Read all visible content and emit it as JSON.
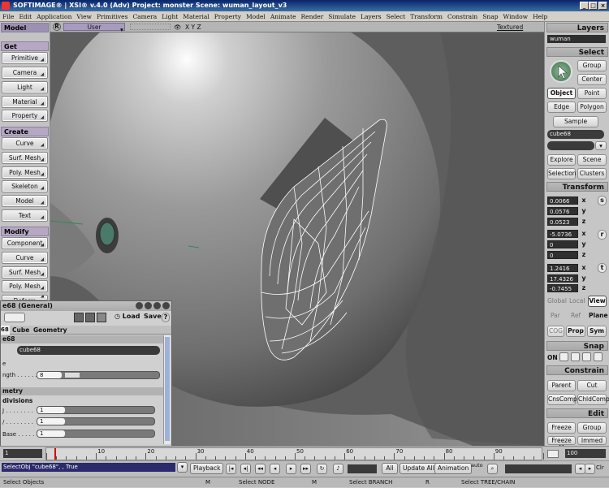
{
  "window": {
    "title": "SOFTIMAGE® | XSI® v.4.0 (Adv) Project: monster    Scene: wuman_layout_v3",
    "minimize": "_",
    "maximize": "□",
    "close": "×"
  },
  "menu": [
    "File",
    "Edit",
    "Application",
    "View",
    "Primitives",
    "Camera",
    "Light",
    "Material",
    "Property",
    "Model",
    "Animate",
    "Render",
    "Simulate",
    "Layers",
    "Select",
    "Transform",
    "Constrain",
    "Snap",
    "Window",
    "Help"
  ],
  "left_panel": {
    "mode": "Model",
    "get_header": "Get",
    "get_items": [
      "Primitive",
      "Camera",
      "Light",
      "Material",
      "Property"
    ],
    "create_header": "Create",
    "create_items": [
      "Curve",
      "Surf. Mesh",
      "Poly. Mesh",
      "Skeleton",
      "Model",
      "Text"
    ],
    "modify_header": "Modify",
    "modify_items": [
      "Component",
      "Curve",
      "Surf. Mesh",
      "Poly. Mesh"
    ],
    "modify_partial": "Deform"
  },
  "viewport": {
    "label": "R",
    "camera": "User",
    "axes": "X Y Z",
    "display_mode": "Textured"
  },
  "right_panel": {
    "layers_header": "Layers",
    "layer_value": "wuman",
    "select_header": "Select",
    "select_buttons": [
      "Group",
      "Center"
    ],
    "component_buttons": [
      "Object",
      "Point",
      "Edge",
      "Polygon"
    ],
    "sample": "Sample",
    "selection_name": "cube68",
    "selection_name2": "",
    "explore": "Explore",
    "scene": "Scene",
    "selection": "Selection",
    "clusters": "Clusters",
    "transform_header": "Transform",
    "scale": [
      "0.0066",
      "0.0576",
      "0.0523"
    ],
    "rotate": [
      "-5.0736",
      "0",
      "0"
    ],
    "translate": [
      "1.2416",
      "17.4326",
      "-0.7455"
    ],
    "axes": [
      "x",
      "y",
      "z"
    ],
    "scale_icon": "s",
    "rotate_icon": "r",
    "translate_icon": "t",
    "space": [
      "Global",
      "Local",
      "View"
    ],
    "ref": [
      "Par",
      "Ref",
      "Plane"
    ],
    "cog": [
      "COG",
      "Prop",
      "Sym"
    ],
    "snap_header": "Snap",
    "snap_on": "ON",
    "constrain_header": "Constrain",
    "constrain_buttons": [
      "Parent",
      "Cut",
      "CnsComp",
      "ChldComp"
    ],
    "edit_header": "Edit",
    "edit_buttons": [
      "Freeze",
      "Group",
      "Freeze M",
      "Immed"
    ]
  },
  "property_panel": {
    "title": "e68 (General)",
    "load": "Load",
    "save": "Save",
    "help": "?",
    "tabs": [
      "68",
      "Cube",
      "Geometry"
    ],
    "section1": "e68",
    "name_value": "cube68",
    "row_e": "e",
    "length_label": "ngth . . . . . .",
    "length_value": "8",
    "length_fraction": 0.3,
    "section2": "metry",
    "section3": "divisions",
    "div_labels": [
      "J . . . . . . . .",
      "/ . . . . . . . .",
      "Base . . . . . ."
    ],
    "div_values": [
      "1",
      "1",
      "1"
    ]
  },
  "timeline": {
    "start": "1",
    "ticks": [
      "10",
      "20",
      "30",
      "40",
      "50",
      "60",
      "70",
      "80",
      "90"
    ],
    "end": "100",
    "current_frame": 1
  },
  "controls": {
    "command": "SelectObj \"cube68\", , True",
    "playback": "Playback",
    "all": "All",
    "update_all": "Update All",
    "animation": "Animation",
    "auto": "auto",
    "clr": "Clr"
  },
  "status": {
    "left": "Select Objects",
    "m_label": "M",
    "mid": "Select NODE",
    "mid_key": "M",
    "right_label": "Select BRANCH",
    "r_key": "R",
    "far_right": "Select TREE/CHAIN"
  }
}
